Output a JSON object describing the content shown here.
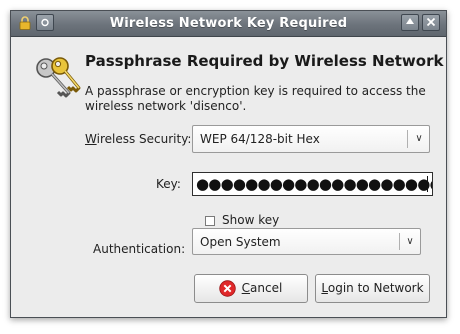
{
  "window": {
    "title": "Wireless Network Key Required",
    "controls": {
      "menu_icon": "lock-icon",
      "pin_icon": "pin-icon",
      "maximize_icon": "arrow-up-icon",
      "close_icon": "close-icon"
    }
  },
  "dialog": {
    "icon": "keys-icon",
    "heading": "Passphrase Required by Wireless Network",
    "description": "A passphrase or encryption key is required to access the wireless network 'disenco'."
  },
  "form": {
    "wireless_security": {
      "label_mnemonic": "W",
      "label_rest": "ireless Security:",
      "value": "WEP 64/128-bit Hex"
    },
    "key": {
      "label": "Key:",
      "masked_value": "●●●●●●●●●●●●●●●●●●●●●●●●●●"
    },
    "show_key": {
      "label": "Show key",
      "checked": false
    },
    "authentication": {
      "label": "Authentication:",
      "value": "Open System"
    }
  },
  "buttons": {
    "cancel_mnemonic": "C",
    "cancel_rest": "ancel",
    "cancel_icon": "cancel-icon",
    "login_mnemonic": "L",
    "login_rest": "ogin to Network"
  },
  "colors": {
    "titlebar": "#6c737b",
    "dialog_bg": "#ececec",
    "cancel_red": "#e0282a"
  }
}
